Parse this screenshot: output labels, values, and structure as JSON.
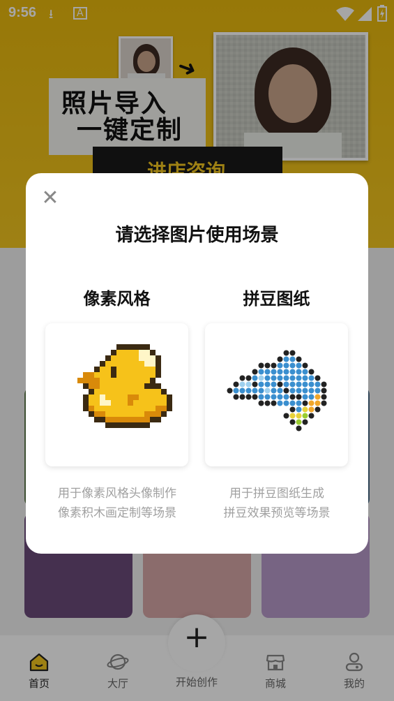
{
  "status_bar": {
    "time": "9:56",
    "icons": [
      "download-icon",
      "app-notification-icon",
      "wifi-icon",
      "signal-icon",
      "battery-charging-icon"
    ]
  },
  "banner": {
    "title_line1": "照片导入",
    "title_line2": "一键定制",
    "consult_label": "进店咨询",
    "colors": {
      "background": "#f1c21b",
      "button": "#1a1a1a",
      "button_text": "#f3c620"
    }
  },
  "modal": {
    "close_icon": "close-icon",
    "title": "请选择图片使用场景",
    "options": [
      {
        "title": "像素风格",
        "desc_line1": "用于像素风格头像制作",
        "desc_line2": "像素积木画定制等场景",
        "image": "pixel-duck-icon"
      },
      {
        "title": "拼豆图纸",
        "desc_line1": "用于拼豆图纸生成",
        "desc_line2": "拼豆效果预览等场景",
        "image": "bead-dolphin-icon"
      }
    ]
  },
  "tabbar": {
    "tabs": [
      {
        "label": "首页",
        "icon": "home-icon",
        "active": true
      },
      {
        "label": "大厅",
        "icon": "planet-icon"
      },
      {
        "label": "开始创作",
        "icon": "plus-icon"
      },
      {
        "label": "商城",
        "icon": "shop-icon"
      },
      {
        "label": "我的",
        "icon": "profile-icon"
      }
    ]
  }
}
